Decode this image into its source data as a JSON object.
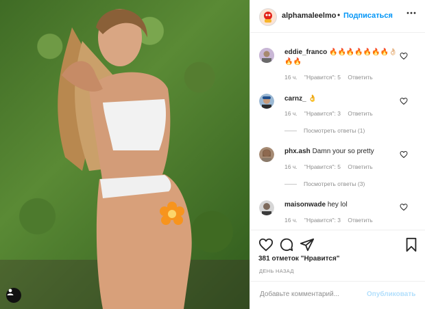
{
  "post": {
    "username": "alphamaleelmo",
    "follow_label": "Подписаться",
    "dot": "•"
  },
  "comments": [
    {
      "username": "eddie_franco",
      "text": "🔥🔥🔥🔥🔥🔥🔥👌🏻🔥🔥",
      "age": "16 ч.",
      "likes": "\"Нравится\": 5",
      "reply": "Ответить",
      "view_replies": ""
    },
    {
      "username": "carnz_",
      "text": "👌",
      "age": "16 ч.",
      "likes": "\"Нравится\": 3",
      "reply": "Ответить",
      "view_replies": "Посмотреть ответы (1)"
    },
    {
      "username": "phx.ash",
      "text": "Damn your so pretty",
      "age": "16 ч.",
      "likes": "\"Нравится\": 5",
      "reply": "Ответить",
      "view_replies": "Посмотреть ответы (3)"
    },
    {
      "username": "maisonwade",
      "text": "hey lol",
      "age": "16 ч.",
      "likes": "\"Нравится\": 3",
      "reply": "Ответить",
      "view_replies": ""
    }
  ],
  "likes_count": "381 отметок \"Нравится\"",
  "posted_time": "ДЕНЬ НАЗАД",
  "comment_box": {
    "placeholder": "Добавьте комментарий...",
    "post_label": "Опубликовать"
  },
  "icons": [
    "heart-icon",
    "comment-icon",
    "share-icon",
    "bookmark-icon",
    "more-icon",
    "user-tag-icon",
    "flower-sticker-icon"
  ],
  "colors": {
    "link": "#0095f6",
    "muted": "#8e8e8e",
    "disabled_post": "#b2dffc",
    "sticker": "#f7941d"
  }
}
